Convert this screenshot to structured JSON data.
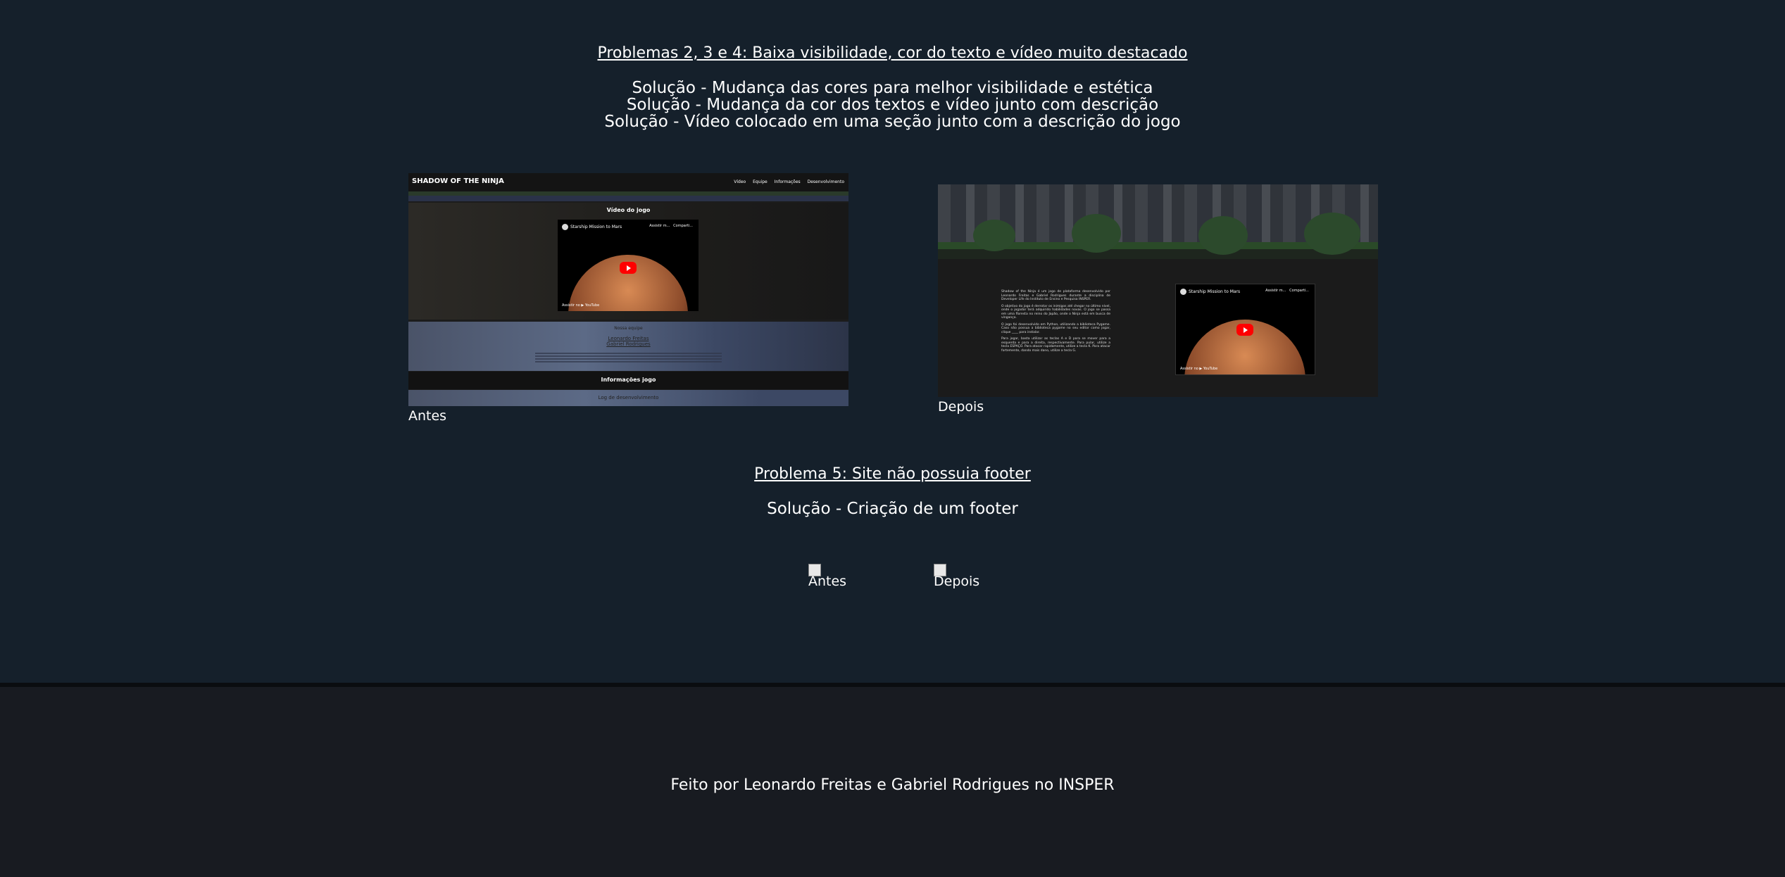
{
  "section1": {
    "title": "Problemas 2, 3 e 4: Baixa visibilidade, cor do texto e vídeo muito destacado",
    "solutions": [
      "Solução - Mudança das cores para melhor visibilidade e estética",
      "Solução - Mudança da cor dos textos e vídeo junto com descrição",
      "Solução - Vídeo colocado em uma seção junto com a descrição do jogo"
    ],
    "before_caption": "Antes",
    "after_caption": "Depois",
    "before_shot": {
      "logo": "SHADOW OF THE NINJA",
      "nav": [
        "Vídeo",
        "Equipe",
        "Informações",
        "Desenvolvimento"
      ],
      "video_title": "Vídeo do jogo",
      "yt_title": "Starship Mission to Mars",
      "yt_side": [
        "Assistir m...",
        "Comparti..."
      ],
      "yt_watch": "Assistir no ▶ YouTube",
      "team_title": "Nossa equipe",
      "team_names": [
        "Leonardo Freitas",
        "Gabriel Rodrigues"
      ],
      "info_title": "Informações jogo",
      "log_title": "Log de desenvolvimento"
    },
    "after_shot": {
      "yt_title": "Starship Mission to Mars",
      "yt_side": [
        "Assistir m...",
        "Comparti..."
      ],
      "yt_watch": "Assistir no ▶ YouTube",
      "paragraphs": [
        "Shadow of the Ninja é um jogo de plataforma desenvolvido por Leonardo Freitas e Gabriel Rodrigues durante a disciplina de Developer Life do Instituto de Ensino e Pesquisa INSPER.",
        "O objetivo do jogo é derrotar os inimigos até chegar no último nível, onde o jogador terá adquirido habilidades novas. O jogo se passa em uma floresta no reino do Japão, onde o Ninja está em busca de vingança.",
        "O jogo foi desenvolvido em Python, utilizando a biblioteca Pygame. Caso não possua a biblioteca pygame no seu editor como jogar, clique ____ para instalar.",
        "Para jogar, basta utilizar as teclas A e D para se mover para a esquerda e para a direita, respectivamente. Para pular, utilize a tecla ESPAÇO. Para atacar rapidamente, utilize a tecla K. Para atacar fortemente, dando mais dano, utilize a tecla G."
      ]
    }
  },
  "section2": {
    "title": "Problema 5: Site não possuia footer",
    "solution": "Solução - Criação de um footer",
    "before_caption": "Antes",
    "after_caption": "Depois"
  },
  "footer": {
    "text": "Feito por Leonardo Freitas e Gabriel Rodrigues no INSPER"
  },
  "colors": {
    "background": "#15202b",
    "footer_background": "#181b21",
    "footer_border": "#0a0d10",
    "text": "#ffffff"
  }
}
